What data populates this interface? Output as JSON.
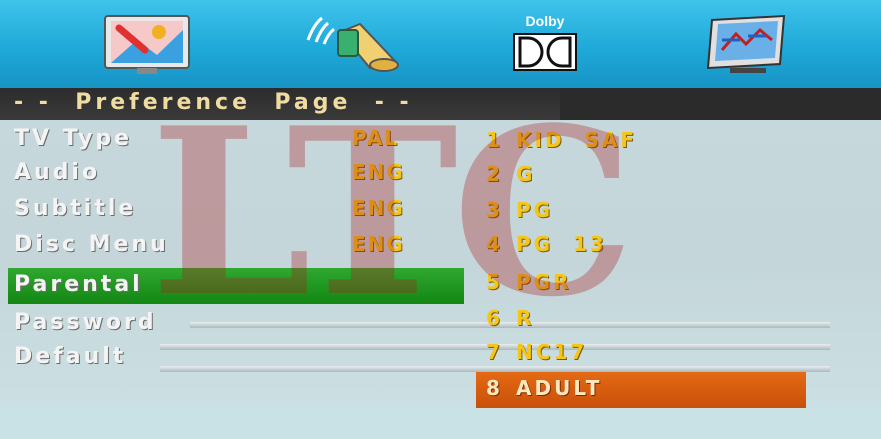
{
  "top_icons": [
    {
      "name": "picture-setup-icon"
    },
    {
      "name": "audio-setup-icon"
    },
    {
      "name": "dolby-setup-icon",
      "caption": "Dolby"
    },
    {
      "name": "preference-setup-icon"
    }
  ],
  "page_title": "- -  Preference  Page  - -",
  "menu": [
    {
      "label": "TV  Type",
      "value": "PAL"
    },
    {
      "label": "Audio",
      "value": "ENG"
    },
    {
      "label": "Subtitle",
      "value": "ENG"
    },
    {
      "label": "Disc  Menu",
      "value": "ENG"
    },
    {
      "label": "Parental",
      "value": ""
    },
    {
      "label": "Password",
      "value": ""
    },
    {
      "label": "Default",
      "value": ""
    }
  ],
  "selected_menu_item": "Parental",
  "parental_options": [
    {
      "num": "1",
      "label": "KID  SAF"
    },
    {
      "num": "2",
      "label": "G"
    },
    {
      "num": "3",
      "label": "PG"
    },
    {
      "num": "4",
      "label": "PG  13"
    },
    {
      "num": "5",
      "label": "PGR"
    },
    {
      "num": "6",
      "label": "R"
    },
    {
      "num": "7",
      "label": "NC17"
    },
    {
      "num": "8",
      "label": "ADULT"
    }
  ],
  "selected_option": "ADULT",
  "watermark": "LTC",
  "colors": {
    "highlight_menu": "#1a8f1a",
    "highlight_option": "#d65c10",
    "value_text": "#f5c518",
    "icon_bar": "#22aadc"
  }
}
